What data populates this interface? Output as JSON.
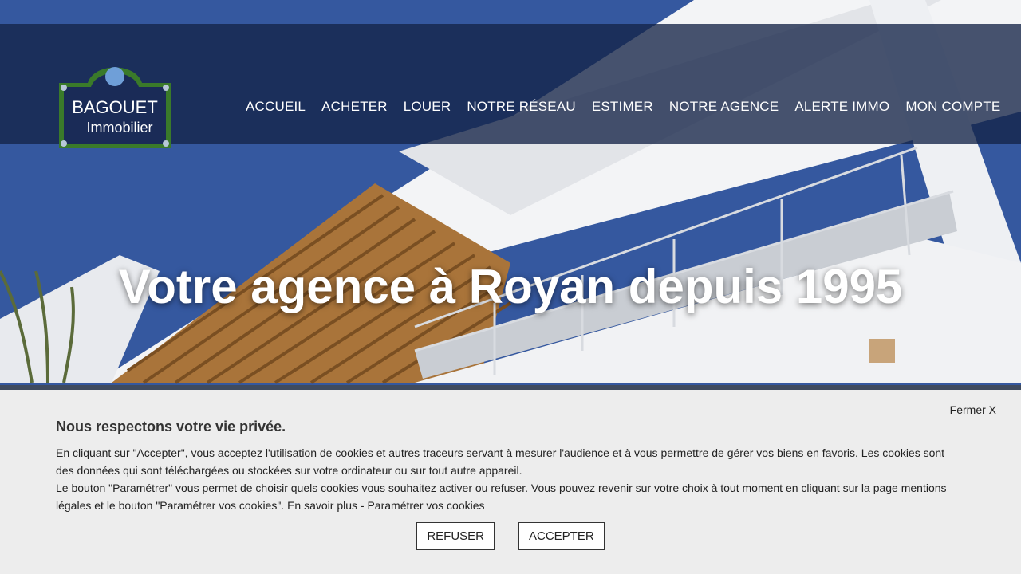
{
  "brand": {
    "logo_line1": "BAGOUET",
    "logo_line2": "Immobilier",
    "colors": {
      "green": "#3a7a2a",
      "navy": "#1a2b57"
    }
  },
  "nav": {
    "items": [
      {
        "label": "ACCUEIL"
      },
      {
        "label": "ACHETER"
      },
      {
        "label": "LOUER"
      },
      {
        "label": "NOTRE RÉSEAU"
      },
      {
        "label": "ESTIMER"
      },
      {
        "label": "NOTRE AGENCE"
      },
      {
        "label": "ALERTE IMMO"
      },
      {
        "label": "MON COMPTE"
      }
    ]
  },
  "hero": {
    "headline": "Votre agence à Royan depuis 1995"
  },
  "cookie_banner": {
    "close_label": "Fermer X",
    "title": "Nous respectons votre vie privée.",
    "paragraph1": "En cliquant sur \"Accepter\", vous acceptez l'utilisation de cookies et autres traceurs servant à mesurer l'audience et à vous permettre de gérer vos biens en favoris. Les cookies sont des données qui sont téléchargées ou stockées sur votre ordinateur ou sur tout autre appareil.",
    "paragraph2": "Le bouton \"Paramétrer\" vous permet de choisir quels cookies vous souhaitez activer ou refuser. Vous pouvez revenir sur votre choix à tout moment en cliquant sur la page mentions légales et le bouton \"Paramétrer vos cookies\". En savoir plus - Paramétrer vos cookies",
    "refuse_label": "REFUSER",
    "accept_label": "ACCEPTER"
  }
}
